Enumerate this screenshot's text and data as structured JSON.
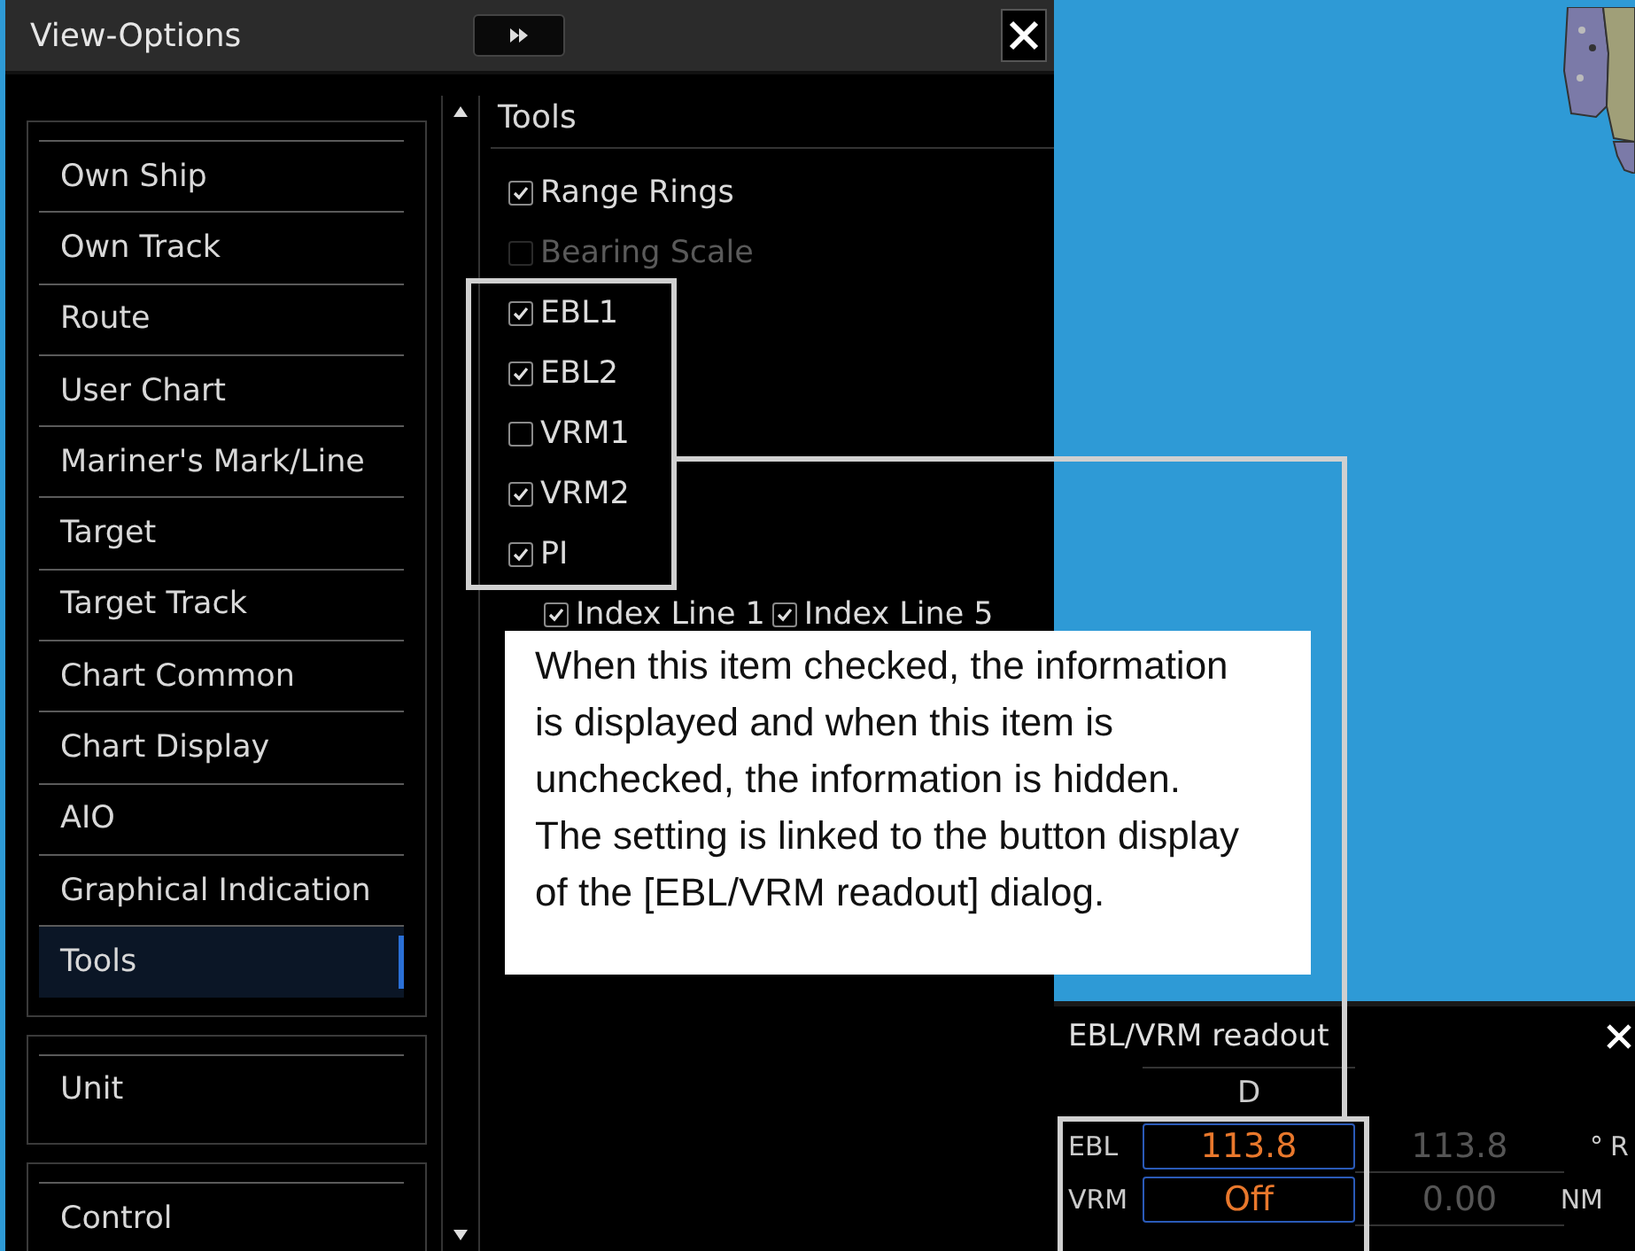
{
  "window": {
    "title": "View-Options"
  },
  "nav_groups": [
    {
      "items": [
        {
          "label": "Own Ship",
          "selected": false
        },
        {
          "label": "Own Track",
          "selected": false
        },
        {
          "label": "Route",
          "selected": false
        },
        {
          "label": "User Chart",
          "selected": false
        },
        {
          "label": "Mariner's Mark/Line",
          "selected": false
        },
        {
          "label": "Target",
          "selected": false
        },
        {
          "label": "Target Track",
          "selected": false
        },
        {
          "label": "Chart Common",
          "selected": false
        },
        {
          "label": "Chart Display",
          "selected": false
        },
        {
          "label": "AIO",
          "selected": false
        },
        {
          "label": "Graphical Indication",
          "selected": false
        },
        {
          "label": "Tools",
          "selected": true
        }
      ]
    },
    {
      "items": [
        {
          "label": "Unit",
          "selected": false
        }
      ]
    },
    {
      "items": [
        {
          "label": "Control",
          "selected": false
        }
      ]
    }
  ],
  "panel": {
    "title": "Tools",
    "options": [
      {
        "label": "Range Rings",
        "checked": true,
        "disabled": false
      },
      {
        "label": "Bearing Scale",
        "checked": false,
        "disabled": true
      },
      {
        "label": "EBL1",
        "checked": true,
        "disabled": false
      },
      {
        "label": "EBL2",
        "checked": true,
        "disabled": false
      },
      {
        "label": "VRM1",
        "checked": false,
        "disabled": false
      },
      {
        "label": "VRM2",
        "checked": true,
        "disabled": false
      },
      {
        "label": "PI",
        "checked": true,
        "disabled": false
      }
    ],
    "sub_options": [
      {
        "label": "Index Line 1",
        "checked": true
      },
      {
        "label": "Index Line 5",
        "checked": true
      }
    ]
  },
  "callout": {
    "text": "When this item checked, the information is displayed and when this item is unchecked, the information is hidden. The setting is linked to the button display of the [EBL/VRM readout] dialog."
  },
  "readout": {
    "title": "EBL/VRM readout",
    "column_header": "D",
    "rows": [
      {
        "label": "EBL",
        "value": "113.8",
        "reading": "113.8",
        "unit": "°",
        "column_5": "R"
      },
      {
        "label": "VRM",
        "value": "Off",
        "reading": "0.00",
        "unit": "NM"
      }
    ]
  }
}
